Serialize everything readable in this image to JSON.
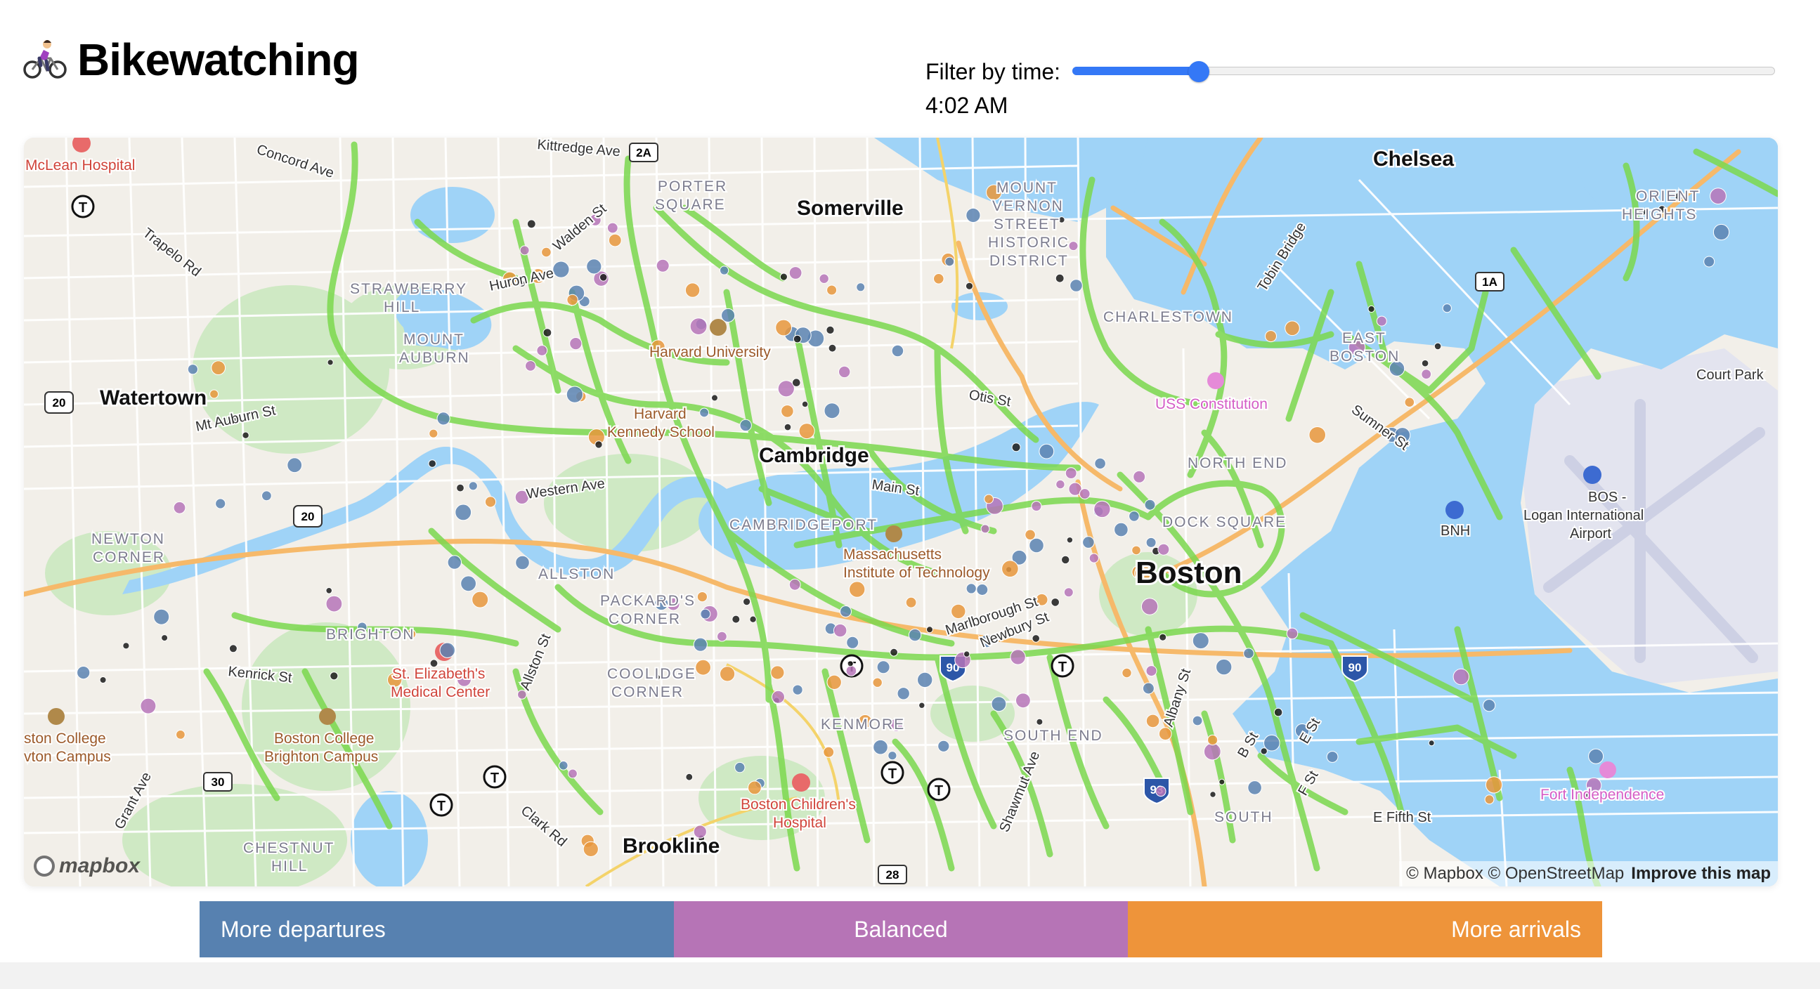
{
  "header": {
    "title": "Bikewatching",
    "icon": "person-biking-icon"
  },
  "filter": {
    "label": "Filter by time:",
    "time_display": "4:02 AM",
    "slider_fraction": 0.18
  },
  "map": {
    "city_labels": [
      "Boston",
      "Cambridge",
      "Somerville",
      "Chelsea",
      "Watertown",
      "Brookline",
      "Court Park"
    ],
    "neighborhood_labels": [
      "CHARLESTOWN",
      "EAST",
      "BOSTON",
      "ALLSTON",
      "BRIGHTON",
      "NEWTON",
      "CORNER",
      "NORTH END",
      "SOUTH END",
      "SOUTH",
      "CAMBRIDGEPORT",
      "PORTER",
      "SQUARE",
      "STRAWBERRY",
      "HILL",
      "MOUNT",
      "AUBURN",
      "MOUNT",
      "VERNON",
      "STREET",
      "HISTORIC",
      "DISTRICT",
      "ORIENT",
      "HEIGHTS",
      "PACKARD'S",
      "CORNER",
      "COOLIDGE",
      "CORNER",
      "KENMORE",
      "CHESTNUT",
      "HILL",
      "DOCK SQUARE"
    ],
    "poi_labels": [
      "McLean Hospital",
      "Harvard University",
      "Harvard",
      "Kennedy School",
      "Massachusetts",
      "Institute of Technology",
      "St. Elizabeth's",
      "Medical Center",
      "Boston College",
      "Brighton Campus",
      "Boston Children's",
      "Hospital",
      "USS Constitution",
      "BOS -",
      "Logan International",
      "Airport",
      "BNH",
      "Fort Independence",
      "ston College",
      "vton Campus"
    ],
    "street_labels": [
      "Concord Ave",
      "Trapelo Rd",
      "Huron Ave",
      "Walden St",
      "Mt Auburn St",
      "Western Ave",
      "Main St",
      "Otis St",
      "Kenrick St",
      "Allston St",
      "Clark Rd",
      "Marlborough St",
      "Newbury St",
      "Shawmut Ave",
      "Albany St",
      "B St",
      "E St",
      "F St",
      "E Fifth St",
      "Sumner St",
      "Tobin Bridge",
      "Grant Ave",
      "Kittredge Ave"
    ],
    "highway_shields": [
      "2A",
      "1A",
      "20",
      "20",
      "30",
      "28",
      "93",
      "90",
      "90"
    ],
    "attribution": {
      "logo": "mapbox",
      "text": "© Mapbox © OpenStreetMap",
      "improve_link": "Improve this map"
    },
    "stations": {
      "departures_color": "#5a82b1",
      "balanced_color": "#b674b8",
      "arrivals_color": "#e8973c",
      "no_traffic_color": "#1a1a1a"
    },
    "route_color": "#7bd84e"
  },
  "legend": {
    "departures": {
      "label": "More departures",
      "color": "#5781b0"
    },
    "balanced": {
      "label": "Balanced",
      "color": "#b674b6"
    },
    "arrivals": {
      "label": "More arrivals",
      "color": "#ee943a"
    }
  }
}
